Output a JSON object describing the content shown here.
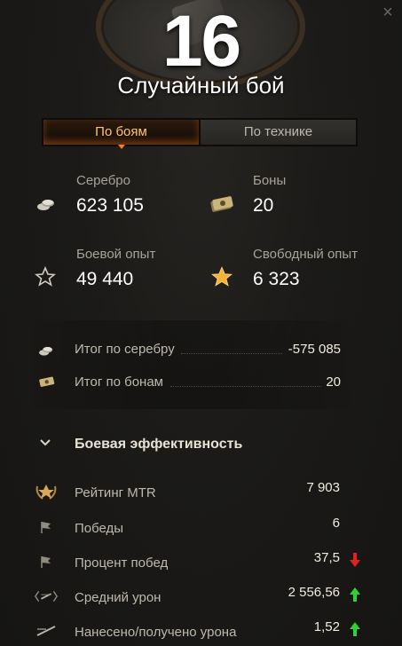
{
  "header": {
    "battle_number": "16",
    "battle_type": "Случайный бой",
    "close_glyph": "×"
  },
  "tabs": [
    {
      "label": "По боям",
      "active": true
    },
    {
      "label": "По технике",
      "active": false
    }
  ],
  "stats": {
    "silver": {
      "label": "Серебро",
      "value": "623 105",
      "icon": "silver-coins-icon"
    },
    "bonds": {
      "label": "Боны",
      "value": "20",
      "icon": "bonds-icon"
    },
    "battle_xp": {
      "label": "Боевой опыт",
      "value": "49 440",
      "icon": "star-outline-icon"
    },
    "free_xp": {
      "label": "Свободный опыт",
      "value": "6 323",
      "icon": "star-gold-icon"
    }
  },
  "summary": {
    "silver_total": {
      "label": "Итог по серебру",
      "value": "-575 085"
    },
    "bonds_total": {
      "label": "Итог по бонам",
      "value": "20"
    }
  },
  "efficiency": {
    "title": "Боевая эффективность",
    "rows": [
      {
        "label": "Рейтинг MTR",
        "value": "7 903",
        "icon": "mtr-rating-icon",
        "trend": "none"
      },
      {
        "label": "Победы",
        "value": "6",
        "icon": "flag-icon",
        "trend": "none"
      },
      {
        "label": "Процент побед",
        "value": "37,5",
        "icon": "flag-icon",
        "trend": "down"
      },
      {
        "label": "Средний урон",
        "value": "2 556,56",
        "icon": "damage-icon",
        "trend": "up"
      },
      {
        "label": "Нанесено/получено урона",
        "value": "1,52",
        "icon": "damage-ratio-icon",
        "trend": "up"
      }
    ]
  },
  "colors": {
    "accent_orange": "#ffc46a",
    "trend_up": "#2fd135",
    "trend_down": "#e0231d"
  }
}
